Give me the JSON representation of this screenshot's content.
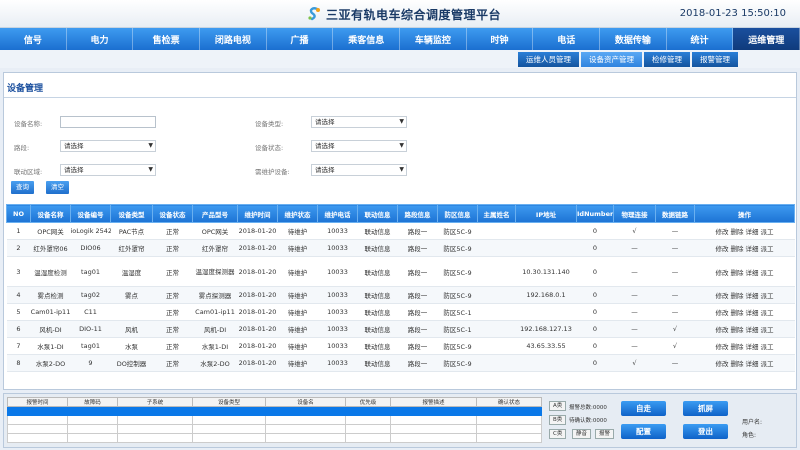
{
  "header": {
    "title": "三亚有轨电车综合调度管理平台",
    "datetime": "2018-01-23 15:50:10",
    "logo_icon": "app-logo-icon"
  },
  "nav": {
    "items": [
      "信号",
      "电力",
      "售检票",
      "闭路电视",
      "广播",
      "乘客信息",
      "车辆监控",
      "时钟",
      "电话",
      "数据传输",
      "统计",
      "运维管理"
    ],
    "active_index": 11
  },
  "subnav": {
    "items": [
      "运维人员管理",
      "设备资产管理",
      "检修管理",
      "报警管理"
    ],
    "active_index": 1
  },
  "panel": {
    "title": "设备管理"
  },
  "filters": {
    "device_name_label": "设备名称:",
    "device_name_value": "",
    "device_type_label": "设备类型:",
    "device_type_value": "请选择",
    "route_label": "路段:",
    "route_value": "请选择",
    "device_status_label": "设备状态:",
    "device_status_value": "请选择",
    "linked_area_label": "联动区域:",
    "linked_area_value": "请选择",
    "maintain_device_label": "需维护设备:",
    "maintain_device_value": "请选择",
    "query_label": "查询",
    "clear_label": "清空"
  },
  "table": {
    "columns": [
      "NO",
      "设备名称",
      "设备编号",
      "设备类型",
      "设备状态",
      "产品型号",
      "维护时间",
      "维护状态",
      "维护电话",
      "联动信息",
      "路段信息",
      "防区信息",
      "主属姓名",
      "IP地址",
      "IdNumber",
      "物理连接",
      "数据链路",
      "操作"
    ],
    "rows": [
      {
        "no": "1",
        "name": "OPC网关",
        "code": "ioLogik 2542",
        "type": "PAC节点",
        "status": "正常",
        "model": "OPC网关",
        "mtime": "2018-01-20",
        "mstatus": "待维护",
        "phone": "10033",
        "link": "联动信息",
        "route": "路段一",
        "zone": "防区5C-9",
        "owner": "",
        "ip": "",
        "idnum": "0",
        "phys": "√",
        "datalink": "—"
      },
      {
        "no": "2",
        "name": "红外罩帘06",
        "code": "DIO06",
        "type": "红外罩帘",
        "status": "正常",
        "model": "红外罩帘",
        "mtime": "2018-01-20",
        "mstatus": "待维护",
        "phone": "10033",
        "link": "联动信息",
        "route": "路段一",
        "zone": "防区5C-9",
        "owner": "",
        "ip": "",
        "idnum": "0",
        "phys": "—",
        "datalink": "—"
      },
      {
        "no": "3",
        "name": "温湿度检测",
        "code": "tag01",
        "type": "温湿度",
        "status": "正常",
        "model": "温湿度探测器",
        "mtime": "2018-01-20",
        "mstatus": "待维护",
        "phone": "10033",
        "link": "联动信息",
        "route": "路段一",
        "zone": "防区5C-9",
        "owner": "",
        "ip": "10.30.131.140",
        "idnum": "0",
        "phys": "—",
        "datalink": "—"
      },
      {
        "no": "4",
        "name": "雾点检测",
        "code": "tag02",
        "type": "雾点",
        "status": "正常",
        "model": "雾点探测器",
        "mtime": "2018-01-20",
        "mstatus": "待维护",
        "phone": "10033",
        "link": "联动信息",
        "route": "路段一",
        "zone": "防区5C-9",
        "owner": "",
        "ip": "192.168.0.1",
        "idnum": "0",
        "phys": "—",
        "datalink": "—"
      },
      {
        "no": "5",
        "name": "Cam01-ip11",
        "code": "C11",
        "type": "",
        "status": "正常",
        "model": "Cam01-ip11",
        "mtime": "2018-01-20",
        "mstatus": "待维护",
        "phone": "10033",
        "link": "联动信息",
        "route": "路段一",
        "zone": "防区5C-1",
        "owner": "",
        "ip": "",
        "idnum": "0",
        "phys": "—",
        "datalink": "—"
      },
      {
        "no": "6",
        "name": "风机-DI",
        "code": "DIO-11",
        "type": "风机",
        "status": "正常",
        "model": "风机-DI",
        "mtime": "2018-01-20",
        "mstatus": "待维护",
        "phone": "10033",
        "link": "联动信息",
        "route": "路段一",
        "zone": "防区5C-1",
        "owner": "",
        "ip": "192.168.127.13",
        "idnum": "0",
        "phys": "—",
        "datalink": "√"
      },
      {
        "no": "7",
        "name": "水泵1-DI",
        "code": "tag01",
        "type": "水泵",
        "status": "正常",
        "model": "水泵1-DI",
        "mtime": "2018-01-20",
        "mstatus": "待维护",
        "phone": "10033",
        "link": "联动信息",
        "route": "路段一",
        "zone": "防区5C-9",
        "owner": "",
        "ip": "43.65.33.55",
        "idnum": "0",
        "phys": "—",
        "datalink": "√"
      },
      {
        "no": "8",
        "name": "水泵2-DO",
        "code": "9",
        "type": "DO控制器",
        "status": "正常",
        "model": "水泵2-DO",
        "mtime": "2018-01-20",
        "mstatus": "待维护",
        "phone": "10033",
        "link": "联动信息",
        "route": "路段一",
        "zone": "防区5C-9",
        "owner": "",
        "ip": "",
        "idnum": "0",
        "phys": "√",
        "datalink": "—"
      }
    ],
    "actions": [
      "修改",
      "删除",
      "详细",
      "派工"
    ]
  },
  "alarm": {
    "columns": [
      "报警时间",
      "故障码",
      "子系统",
      "设备类型",
      "设备名",
      "优先级",
      "报警描述",
      "确认状态"
    ],
    "btn_a": "A类",
    "btn_b": "B类",
    "btn_c": "C类",
    "mute_label": "静音",
    "ack_label": "报警",
    "total_label": "报警总数:0000",
    "passive_label": "待确认数:0000",
    "btn_self": "自走",
    "btn_screenshot": "抓屏",
    "btn_config": "配置",
    "btn_logout": "登出",
    "user_label": "用户名:",
    "role_label": "角色:"
  }
}
